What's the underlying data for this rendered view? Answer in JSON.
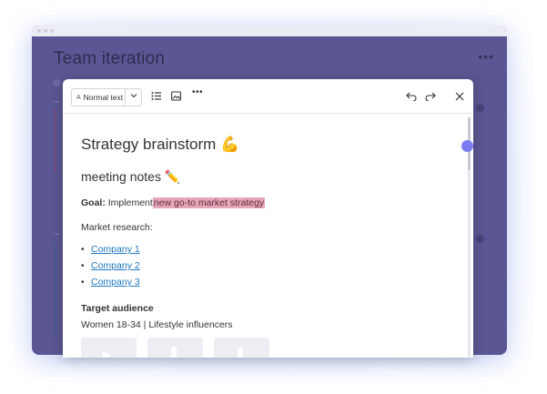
{
  "board": {
    "title": "Team iteration",
    "more_icon": "more-horizontal-icon"
  },
  "toolbar": {
    "text_style": "Normal text",
    "text_style_icon": "text-size-icon",
    "chevron_icon": "chevron-down-icon",
    "bullet_list_icon": "bullet-list-icon",
    "image_icon": "image-icon",
    "more_icon": "more-horizontal-icon",
    "undo_icon": "undo-icon",
    "redo_icon": "redo-icon",
    "close_icon": "close-icon"
  },
  "doc": {
    "heading": "Strategy brainstorm",
    "heading_emoji": "💪",
    "subheading": "meeting notes",
    "subheading_emoji": "✏️",
    "goal_label": "Goal:",
    "goal_text": "Implement",
    "goal_highlight": "new go-to market strategy",
    "market_research_title": "Market research:",
    "bullet": "•",
    "companies": [
      "Company 1",
      "Company 2",
      "Company 3"
    ],
    "target_audience_title": "Target audience",
    "target_audience_text": "Women 18-34  |  Lifestyle influencers"
  },
  "colors": {
    "board_bg": "#5b5794",
    "highlight": "#e6a6b7",
    "link": "#1f76c2",
    "handle": "#7d7bf0"
  }
}
